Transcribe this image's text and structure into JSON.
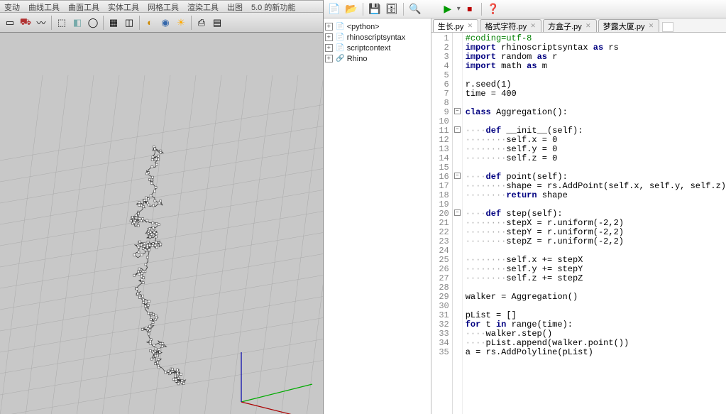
{
  "left_menu": [
    "变动",
    "曲线工具",
    "曲面工具",
    "实体工具",
    "网格工具",
    "渲染工具",
    "出图",
    "5.0 的新功能"
  ],
  "tree": [
    {
      "expander": "+",
      "icon": "📄",
      "label": "<python>"
    },
    {
      "expander": "+",
      "icon": "📄",
      "label": "rhinoscriptsyntax"
    },
    {
      "expander": "+",
      "icon": "📄",
      "label": "scriptcontext"
    },
    {
      "expander": "+",
      "icon": "🔗",
      "label": "Rhino"
    }
  ],
  "tabs": [
    {
      "label": "生长.py",
      "active": true
    },
    {
      "label": "格式字符.py",
      "active": false
    },
    {
      "label": "方盒子.py",
      "active": false
    },
    {
      "label": "梦露大厦.py",
      "active": false
    }
  ],
  "code": [
    {
      "n": 1,
      "segs": [
        {
          "t": "#coding=utf-8",
          "c": "c-green"
        }
      ]
    },
    {
      "n": 2,
      "segs": [
        {
          "t": "import ",
          "c": "c-nav"
        },
        {
          "t": "rhinoscriptsyntax "
        },
        {
          "t": "as ",
          "c": "c-nav"
        },
        {
          "t": "rs"
        }
      ]
    },
    {
      "n": 3,
      "segs": [
        {
          "t": "import ",
          "c": "c-nav"
        },
        {
          "t": "random "
        },
        {
          "t": "as ",
          "c": "c-nav"
        },
        {
          "t": "r"
        }
      ]
    },
    {
      "n": 4,
      "segs": [
        {
          "t": "import ",
          "c": "c-nav"
        },
        {
          "t": "math "
        },
        {
          "t": "as ",
          "c": "c-nav"
        },
        {
          "t": "m"
        }
      ]
    },
    {
      "n": 5,
      "segs": []
    },
    {
      "n": 6,
      "segs": [
        {
          "t": "r.seed(1)"
        }
      ]
    },
    {
      "n": 7,
      "segs": [
        {
          "t": "time = 400"
        }
      ]
    },
    {
      "n": 8,
      "segs": []
    },
    {
      "n": 9,
      "fold": true,
      "segs": [
        {
          "t": "class ",
          "c": "c-nav"
        },
        {
          "t": "Aggregation():"
        }
      ]
    },
    {
      "n": 10,
      "segs": []
    },
    {
      "n": 11,
      "fold": true,
      "segs": [
        {
          "t": "····",
          "c": "c-dot"
        },
        {
          "t": "def ",
          "c": "c-nav"
        },
        {
          "t": "__init__"
        },
        {
          "t": "(self):"
        }
      ]
    },
    {
      "n": 12,
      "segs": [
        {
          "t": "········",
          "c": "c-dot"
        },
        {
          "t": "self.x = 0"
        }
      ]
    },
    {
      "n": 13,
      "segs": [
        {
          "t": "········",
          "c": "c-dot"
        },
        {
          "t": "self.y = 0"
        }
      ]
    },
    {
      "n": 14,
      "segs": [
        {
          "t": "········",
          "c": "c-dot"
        },
        {
          "t": "self.z = 0"
        }
      ]
    },
    {
      "n": 15,
      "segs": []
    },
    {
      "n": 16,
      "fold": true,
      "segs": [
        {
          "t": "····",
          "c": "c-dot"
        },
        {
          "t": "def ",
          "c": "c-nav"
        },
        {
          "t": "point"
        },
        {
          "t": "(self):"
        }
      ]
    },
    {
      "n": 17,
      "segs": [
        {
          "t": "········",
          "c": "c-dot"
        },
        {
          "t": "shape = rs.AddPoint(self.x, self.y, self.z)"
        }
      ]
    },
    {
      "n": 18,
      "segs": [
        {
          "t": "········",
          "c": "c-dot"
        },
        {
          "t": "return ",
          "c": "c-nav"
        },
        {
          "t": "shape"
        }
      ]
    },
    {
      "n": 19,
      "segs": []
    },
    {
      "n": 20,
      "fold": true,
      "segs": [
        {
          "t": "····",
          "c": "c-dot"
        },
        {
          "t": "def ",
          "c": "c-nav"
        },
        {
          "t": "step"
        },
        {
          "t": "(self):"
        }
      ]
    },
    {
      "n": 21,
      "segs": [
        {
          "t": "········",
          "c": "c-dot"
        },
        {
          "t": "stepX = r.uniform(-2,2)"
        }
      ]
    },
    {
      "n": 22,
      "segs": [
        {
          "t": "········",
          "c": "c-dot"
        },
        {
          "t": "stepY = r.uniform(-2,2)"
        }
      ]
    },
    {
      "n": 23,
      "segs": [
        {
          "t": "········",
          "c": "c-dot"
        },
        {
          "t": "stepZ = r.uniform(-2,2)"
        }
      ]
    },
    {
      "n": 24,
      "segs": []
    },
    {
      "n": 25,
      "segs": [
        {
          "t": "········",
          "c": "c-dot"
        },
        {
          "t": "self.x += stepX"
        }
      ]
    },
    {
      "n": 26,
      "segs": [
        {
          "t": "········",
          "c": "c-dot"
        },
        {
          "t": "self.y += stepY"
        }
      ]
    },
    {
      "n": 27,
      "segs": [
        {
          "t": "········",
          "c": "c-dot"
        },
        {
          "t": "self.z += stepZ"
        }
      ]
    },
    {
      "n": 28,
      "segs": []
    },
    {
      "n": 29,
      "segs": [
        {
          "t": "walker = Aggregation()"
        }
      ]
    },
    {
      "n": 30,
      "segs": []
    },
    {
      "n": 31,
      "segs": [
        {
          "t": "pList = []"
        }
      ]
    },
    {
      "n": 32,
      "segs": [
        {
          "t": "for ",
          "c": "c-nav"
        },
        {
          "t": "t "
        },
        {
          "t": "in ",
          "c": "c-nav"
        },
        {
          "t": "range(time):"
        }
      ]
    },
    {
      "n": 33,
      "segs": [
        {
          "t": "····",
          "c": "c-dot"
        },
        {
          "t": "walker.step()"
        }
      ]
    },
    {
      "n": 34,
      "segs": [
        {
          "t": "····",
          "c": "c-dot"
        },
        {
          "t": "pList.append(walker.point())"
        }
      ]
    },
    {
      "n": 35,
      "segs": [
        {
          "t": "a = rs.AddPolyline(pList)"
        }
      ]
    }
  ],
  "ide_icons": {
    "new": "📄",
    "open": "📂",
    "save": "💾",
    "saveall": "🗄",
    "search": "🔍",
    "run": "▶",
    "stop": "⏹",
    "help": "❓"
  }
}
